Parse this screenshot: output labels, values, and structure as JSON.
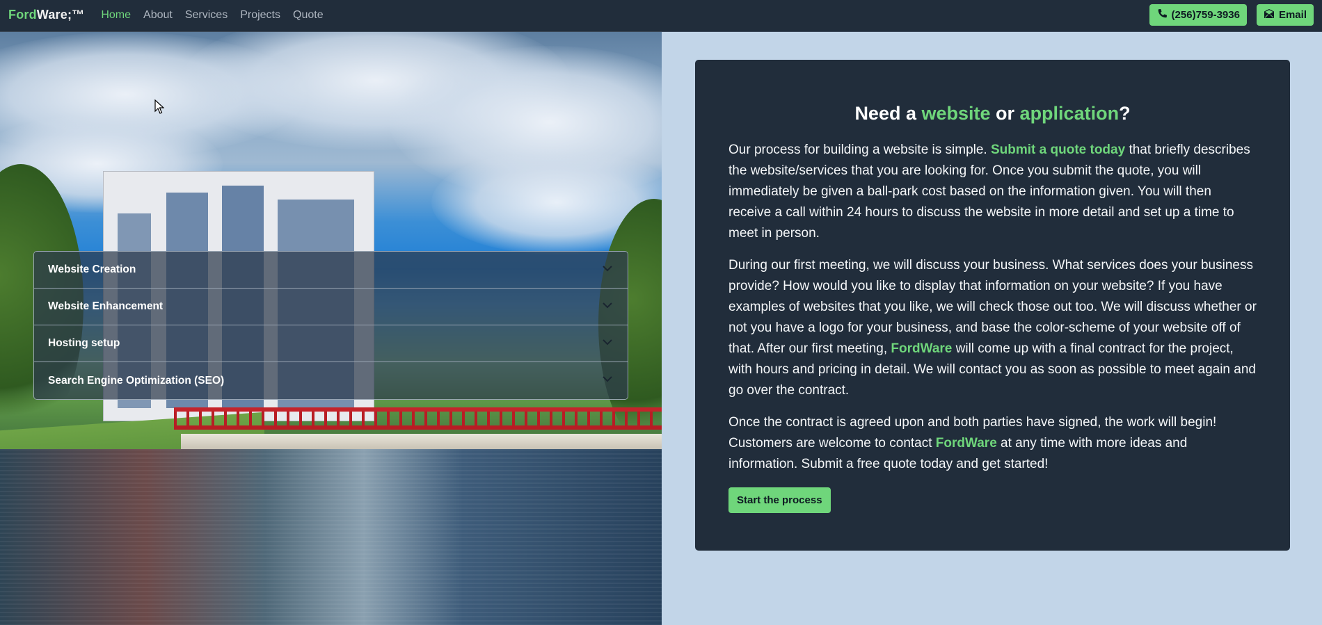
{
  "nav": {
    "brand_accent": "Ford",
    "brand_rest": "Ware;™",
    "links": [
      "Home",
      "About",
      "Services",
      "Projects",
      "Quote"
    ],
    "active": "Home",
    "phone_label": "(256)759-3936",
    "email_label": "Email"
  },
  "accordion": {
    "items": [
      "Website Creation",
      "Website Enhancement",
      "Hosting setup",
      "Search Engine Optimization (SEO)"
    ]
  },
  "card": {
    "title_pre": "Need a ",
    "title_w1": "website",
    "title_mid": " or ",
    "title_w2": "application",
    "title_post": "?",
    "p1_pre": "Our process for building a website is simple. ",
    "p1_hl": "Submit a quote today",
    "p1_post": " that briefly describes the website/services that you are looking for. Once you submit the quote, you will immediately be given a ball-park cost based on the information given. You will then receive a call within 24 hours to discuss the website in more detail and set up a time to meet in person.",
    "p2_pre": "During our first meeting, we will discuss your business. What services does your business provide? How would you like to display that information on your website? If you have examples of websites that you like, we will check those out too. We will discuss whether or not you have a logo for your business, and base the color-scheme of your website off of that. After our first meeting, ",
    "p2_hl": "FordWare",
    "p2_post": " will come up with a final contract for the project, with hours and pricing in detail. We will contact you as soon as possible to meet again and go over the contract.",
    "p3_pre": "Once the contract is agreed upon and both parties have signed, the work will begin! Customers are welcome to contact ",
    "p3_hl": "FordWare",
    "p3_post": " at any time with more ideas and information. Submit a free quote today and get started!",
    "button_label": "Start the process"
  },
  "colors": {
    "accent": "#6fd67b",
    "navbar_bg": "#212d3b",
    "card_bg": "#212d3b",
    "page_bg": "#c2d5e8"
  },
  "icons": {
    "phone": "phone-icon",
    "email": "envelope-icon",
    "chevron": "chevron-down-icon"
  }
}
